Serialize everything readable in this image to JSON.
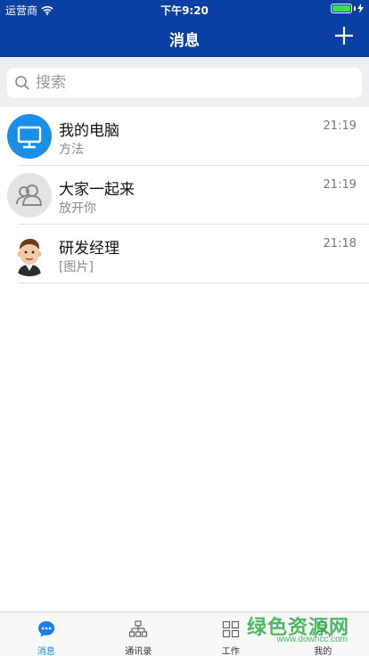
{
  "status_bar": {
    "carrier": "运营商",
    "time": "下午9:20",
    "wifi_icon": "wifi-icon",
    "battery_icon": "battery-icon",
    "battery_level": 1.0
  },
  "nav": {
    "title": "消息",
    "add_icon": "plus-icon"
  },
  "search": {
    "placeholder": "搜索",
    "icon": "search-icon"
  },
  "conversations": [
    {
      "name": "我的电脑",
      "preview": "方法",
      "time": "21:19",
      "avatar": "monitor-icon"
    },
    {
      "name": "大家一起来",
      "preview": "放开你",
      "time": "21:19",
      "avatar": "group-icon"
    },
    {
      "name": "研发经理",
      "preview": "[图片]",
      "time": "21:18",
      "avatar": "person-photo"
    }
  ],
  "tabbar": {
    "tabs": [
      {
        "label": "消息",
        "icon": "chat-icon",
        "active": true
      },
      {
        "label": "通讯录",
        "icon": "org-chart-icon",
        "active": false
      },
      {
        "label": "工作",
        "icon": "grid-icon",
        "active": false
      },
      {
        "label": "我的",
        "icon": "user-icon",
        "active": false
      }
    ]
  },
  "watermark": {
    "text": "绿色资源网",
    "url": "www.downcc.com"
  },
  "colors": {
    "header": "#0a3fa4",
    "accent": "#1a7df0",
    "search_bg": "#eeeff3",
    "watermark": "#2fae4a"
  }
}
